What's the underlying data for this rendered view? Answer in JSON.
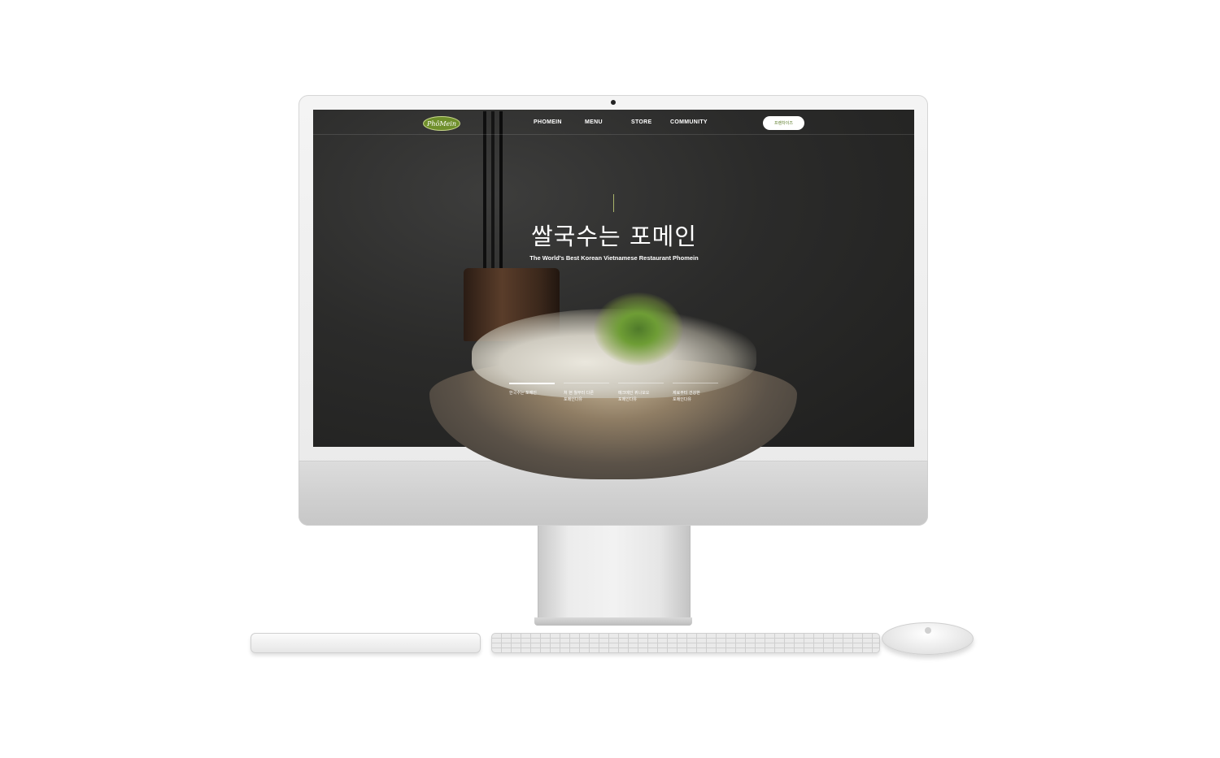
{
  "site": {
    "logo_text": "PhôMein",
    "nav": [
      "PHOMEIN",
      "MENU",
      "STORE",
      "COMMUNITY"
    ],
    "cta_label": "프랜차이즈",
    "hero": {
      "title": "쌀국수는 포메인",
      "subtitle": "The World's Best Korean Vietnamese Restaurant Phomein"
    },
    "tabs": [
      "한국수는 포메인",
      "처 현 월부터 다른 포메인다유",
      "메크메인 뀌나모오 포메인다유",
      "제료부터 건강한 포메인다유"
    ]
  },
  "colors": {
    "accent": "#6f8f2c",
    "screen_bg": "#2b2b2a"
  }
}
